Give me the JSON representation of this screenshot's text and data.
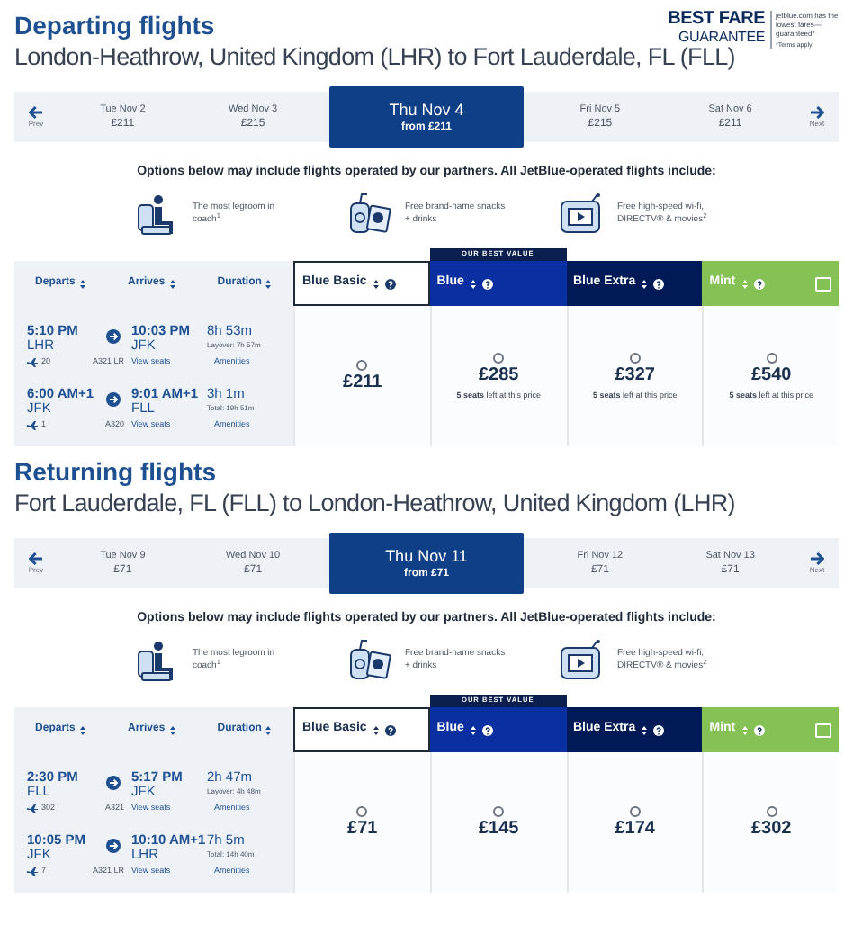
{
  "guarantee": {
    "title": "BEST FARE",
    "subtitle": "GUARANTEE",
    "note": "jetblue.com has the lowest fares—guaranteed*",
    "terms": "*Terms apply"
  },
  "sections": [
    {
      "title": "Departing flights",
      "route": "London-Heathrow, United Kingdom (LHR) to Fort Lauderdale, FL (FLL)",
      "prev": "Prev",
      "next": "Next",
      "days": [
        {
          "day": "Tue Nov 2",
          "price": "£211",
          "selected": false
        },
        {
          "day": "Wed Nov 3",
          "price": "£215",
          "selected": false
        },
        {
          "day": "Thu Nov 4",
          "price": "from £211",
          "selected": true
        },
        {
          "day": "Fri Nov 5",
          "price": "£215",
          "selected": false
        },
        {
          "day": "Sat Nov 6",
          "price": "£211",
          "selected": false
        }
      ],
      "options_note": "Options below may include flights operated by our partners. All JetBlue-operated flights include:",
      "amenities": [
        {
          "kind": "seat",
          "text": "The most legroom in coach$^{1}$"
        },
        {
          "kind": "snacks",
          "text": "Free brand-name snacks + drinks"
        },
        {
          "kind": "tv",
          "text": "Free high-speed wi-fi, DIRECTV® & movies$^{2}$"
        }
      ],
      "columns": [
        "Departs",
        "Arrives",
        "Duration"
      ],
      "fares": [
        {
          "name": "Blue Basic",
          "color": "#ffffff"
        },
        {
          "name": "Blue",
          "color": "#0a2fa0",
          "badge": "OUR BEST VALUE"
        },
        {
          "name": "Blue Extra",
          "color": "#001a57"
        },
        {
          "name": "Mint",
          "color": "#86c155",
          "checked": false
        }
      ],
      "segments": [
        {
          "depart_time": "5:10 PM",
          "depart_airport": "LHR",
          "arrive_time": "10:03 PM",
          "arrive_airport": "JFK",
          "duration": "8h 53m",
          "detail": "Layover: 7h 57m",
          "flight": "20",
          "aircraft": "A321 LR",
          "seats_link": "View seats",
          "amenities_link": "Amenities"
        },
        {
          "depart_time": "6:00 AM+1",
          "depart_airport": "JFK",
          "arrive_time": "9:01 AM+1",
          "arrive_airport": "FLL",
          "duration": "3h 1m",
          "detail": "Total: 19h 51m",
          "flight": "1",
          "aircraft": "A320",
          "seats_link": "View seats",
          "amenities_link": "Amenities"
        }
      ],
      "prices": [
        {
          "price": "£211",
          "selected": false
        },
        {
          "price": "£285",
          "note": "**5 seats** left at this price",
          "selected": false
        },
        {
          "price": "£327",
          "note": "**5 seats** left at this price",
          "selected": false
        },
        {
          "price": "£540",
          "note": "**5 seats** left at this price",
          "selected": false
        }
      ]
    },
    {
      "title": "Returning flights",
      "route": "Fort Lauderdale, FL (FLL) to London-Heathrow, United Kingdom (LHR)",
      "prev": "Prev",
      "next": "Next",
      "days": [
        {
          "day": "Tue Nov 9",
          "price": "£71",
          "selected": false
        },
        {
          "day": "Wed Nov 10",
          "price": "£71",
          "selected": false
        },
        {
          "day": "Thu Nov 11",
          "price": "from £71",
          "selected": true
        },
        {
          "day": "Fri Nov 12",
          "price": "£71",
          "selected": false
        },
        {
          "day": "Sat Nov 13",
          "price": "£71",
          "selected": false
        }
      ],
      "options_note": "Options below may include flights operated by our partners. All JetBlue-operated flights include:",
      "amenities": [
        {
          "kind": "seat",
          "text": "The most legroom in coach$^{1}$"
        },
        {
          "kind": "snacks",
          "text": "Free brand-name snacks + drinks"
        },
        {
          "kind": "tv",
          "text": "Free high-speed wi-fi, DIRECTV® & movies$^{2}$"
        }
      ],
      "columns": [
        "Departs",
        "Arrives",
        "Duration"
      ],
      "fares": [
        {
          "name": "Blue Basic",
          "color": "#ffffff"
        },
        {
          "name": "Blue",
          "color": "#0a2fa0",
          "badge": "OUR BEST VALUE"
        },
        {
          "name": "Blue Extra",
          "color": "#001a57"
        },
        {
          "name": "Mint",
          "color": "#86c155",
          "checked": false
        }
      ],
      "segments": [
        {
          "depart_time": "2:30 PM",
          "depart_airport": "FLL",
          "arrive_time": "5:17 PM",
          "arrive_airport": "JFK",
          "duration": "2h 47m",
          "detail": "Layover: 4h 48m",
          "flight": "302",
          "aircraft": "A321",
          "seats_link": "View seats",
          "amenities_link": "Amenities"
        },
        {
          "depart_time": "10:05 PM",
          "depart_airport": "JFK",
          "arrive_time": "10:10 AM+1",
          "arrive_airport": "LHR",
          "duration": "7h 5m",
          "detail": "Total: 14h 40m",
          "flight": "7",
          "aircraft": "A321 LR",
          "seats_link": "View seats",
          "amenities_link": "Amenities"
        }
      ],
      "prices": [
        {
          "price": "£71",
          "selected": false
        },
        {
          "price": "£145",
          "selected": false
        },
        {
          "price": "£174",
          "selected": false
        },
        {
          "price": "£302",
          "selected": false
        }
      ]
    }
  ]
}
